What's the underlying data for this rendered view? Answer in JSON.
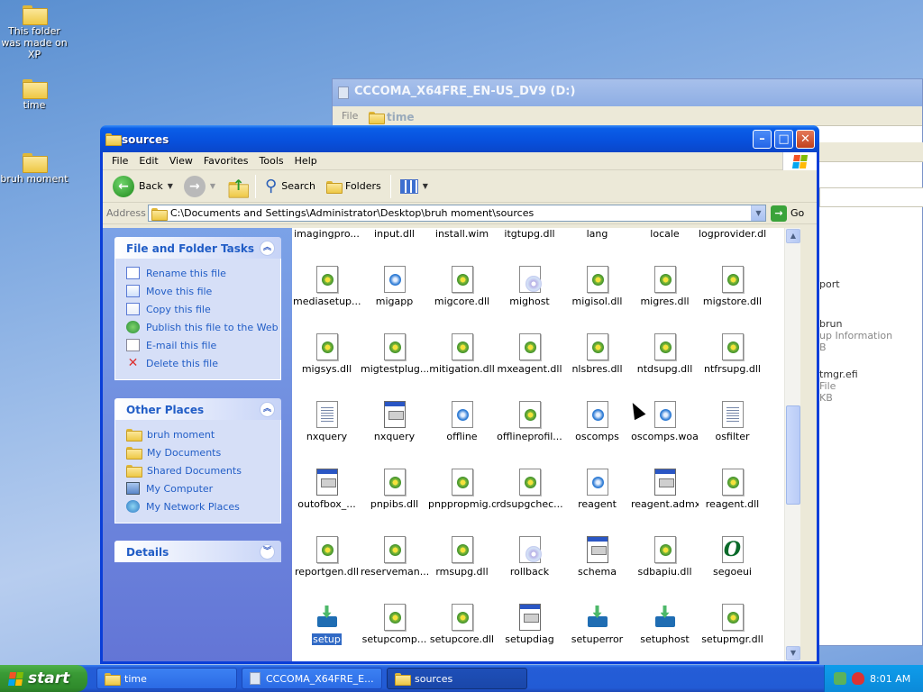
{
  "desktop": {
    "icons": [
      {
        "label": "This folder was made on XP"
      },
      {
        "label": "time"
      },
      {
        "label": "bruh moment"
      }
    ]
  },
  "bg_window": {
    "title": "CCCOMA_X64FRE_EN-US_DV9 (D:)",
    "menu_file": "File",
    "folder": "time",
    "details": [
      {
        "line1": "port",
        "line2": ""
      },
      {
        "line1": "brun",
        "line2": "up Information",
        "line3": "B"
      },
      {
        "line1": "tmgr.efi",
        "line2": "File",
        "line3": "KB"
      }
    ]
  },
  "window": {
    "title": "sources",
    "menu": [
      "File",
      "Edit",
      "View",
      "Favorites",
      "Tools",
      "Help"
    ],
    "toolbar": {
      "back": "Back",
      "search": "Search",
      "folders": "Folders"
    },
    "address": {
      "label": "Address",
      "path": "C:\\Documents and Settings\\Administrator\\Desktop\\bruh moment\\sources",
      "go": "Go"
    }
  },
  "tasks": {
    "file_folder": {
      "title": "File and Folder Tasks",
      "items": [
        "Rename this file",
        "Move this file",
        "Copy this file",
        "Publish this file to the Web",
        "E-mail this file",
        "Delete this file"
      ]
    },
    "other_places": {
      "title": "Other Places",
      "items": [
        "bruh moment",
        "My Documents",
        "Shared Documents",
        "My Computer",
        "My Network Places"
      ]
    },
    "details": {
      "title": "Details"
    }
  },
  "files": [
    {
      "name": "imagingpro...",
      "icon": "dll"
    },
    {
      "name": "input.dll",
      "icon": "dll"
    },
    {
      "name": "install.wim",
      "icon": "doc"
    },
    {
      "name": "itgtupg.dll",
      "icon": "dll"
    },
    {
      "name": "lang",
      "icon": "doc"
    },
    {
      "name": "locale",
      "icon": "doc"
    },
    {
      "name": "logprovider.dll",
      "icon": "dll"
    },
    {
      "name": "mediasetup...",
      "icon": "dll"
    },
    {
      "name": "migapp",
      "icon": "doc"
    },
    {
      "name": "migcore.dll",
      "icon": "dll"
    },
    {
      "name": "mighost",
      "icon": "cd"
    },
    {
      "name": "migisol.dll",
      "icon": "dll"
    },
    {
      "name": "migres.dll",
      "icon": "dll"
    },
    {
      "name": "migstore.dll",
      "icon": "dll"
    },
    {
      "name": "migsys.dll",
      "icon": "dll"
    },
    {
      "name": "migtestplug...",
      "icon": "dll"
    },
    {
      "name": "mitigation.dll",
      "icon": "dll"
    },
    {
      "name": "mxeagent.dll",
      "icon": "dll"
    },
    {
      "name": "nlsbres.dll",
      "icon": "dll"
    },
    {
      "name": "ntdsupg.dll",
      "icon": "dll"
    },
    {
      "name": "ntfrsupg.dll",
      "icon": "dll"
    },
    {
      "name": "nxquery",
      "icon": "scr"
    },
    {
      "name": "nxquery",
      "icon": "app"
    },
    {
      "name": "offline",
      "icon": "doc"
    },
    {
      "name": "offlineprofil...",
      "icon": "dll"
    },
    {
      "name": "oscomps",
      "icon": "doc"
    },
    {
      "name": "oscomps.woa",
      "icon": "doc"
    },
    {
      "name": "osfilter",
      "icon": "scr"
    },
    {
      "name": "outofbox_...",
      "icon": "app"
    },
    {
      "name": "pnpibs.dll",
      "icon": "dll"
    },
    {
      "name": "pnppropmig.dll",
      "icon": "dll"
    },
    {
      "name": "rdsupgchec...",
      "icon": "dll"
    },
    {
      "name": "reagent",
      "icon": "doc"
    },
    {
      "name": "reagent.admx",
      "icon": "app"
    },
    {
      "name": "reagent.dll",
      "icon": "dll"
    },
    {
      "name": "reportgen.dll",
      "icon": "dll"
    },
    {
      "name": "reserveman...",
      "icon": "dll"
    },
    {
      "name": "rmsupg.dll",
      "icon": "dll"
    },
    {
      "name": "rollback",
      "icon": "cd"
    },
    {
      "name": "schema",
      "icon": "app"
    },
    {
      "name": "sdbapiu.dll",
      "icon": "dll"
    },
    {
      "name": "segoeui",
      "icon": "font"
    },
    {
      "name": "setup",
      "icon": "setup",
      "selected": true
    },
    {
      "name": "setupcomp...",
      "icon": "dll"
    },
    {
      "name": "setupcore.dll",
      "icon": "dll"
    },
    {
      "name": "setupdiag",
      "icon": "app"
    },
    {
      "name": "setuperror",
      "icon": "setup"
    },
    {
      "name": "setuphost",
      "icon": "setup"
    },
    {
      "name": "setupmgr.dll",
      "icon": "dll"
    }
  ],
  "taskbar": {
    "start": "start",
    "items": [
      "time",
      "CCCOMA_X64FRE_E...",
      "sources"
    ],
    "clock": "8:01 AM"
  },
  "colors": {
    "xp_blue": "#0a3ed8",
    "task_panel": "#7ba2e7",
    "link": "#215dc6",
    "start_green": "#3a9b36"
  }
}
